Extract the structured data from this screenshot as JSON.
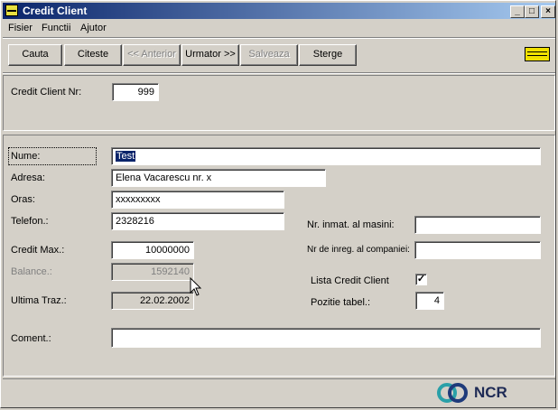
{
  "window": {
    "title": "Credit Client",
    "controls": {
      "minimize": "_",
      "maximize": "□",
      "close": "×"
    }
  },
  "menu": [
    "Fisier",
    "Functii",
    "Ajutor"
  ],
  "toolbar": {
    "cauta": "Cauta",
    "citeste": "Citeste",
    "anterior": "<< Anterior",
    "urmator": "Urmator >>",
    "salveaza": "Salveaza",
    "sterge": "Sterge"
  },
  "header": {
    "nr_label": "Credit Client Nr:",
    "nr_value": "999"
  },
  "form": {
    "nume_label": "Nume:",
    "nume_value": "Test",
    "adresa_label": "Adresa:",
    "adresa_value": "Elena Vacarescu nr. x",
    "oras_label": "Oras:",
    "oras_value": "xxxxxxxxx",
    "telefon_label": "Telefon.:",
    "telefon_value": "2328216",
    "credit_max_label": "Credit Max.:",
    "credit_max_value": "10000000",
    "balance_label": "Balance.:",
    "balance_value": "1592140",
    "ultima_label": "Ultima Traz.:",
    "ultima_value": "22.02.2002",
    "coment_label": "Coment.:",
    "coment_value": "",
    "nr_inmat_label": "Nr. inmat. al masini:",
    "nr_inmat_value": "",
    "nr_inreg_label": "Nr de inreg. al companiei:",
    "nr_inreg_value": "",
    "lista_label": "Lista Credit Client",
    "lista_checked": true,
    "pozitie_label": "Pozitie tabel.:",
    "pozitie_value": "4"
  },
  "footer": {
    "brand": "NCR"
  }
}
